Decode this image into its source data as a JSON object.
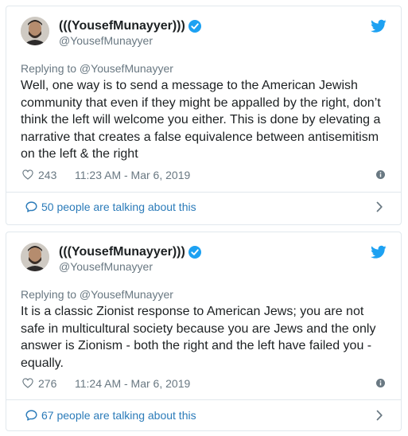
{
  "tweets": [
    {
      "display_name": "(((YousefMunayyer)))",
      "handle": "@YousefMunayyer",
      "replying_to": "Replying to @YousefMunayyer",
      "text": "Well, one way is to send a message to the American Jewish community that even if they might be appalled by the right, don’t think the left will welcome you either. This is done by elevating a narrative that creates a false equivalence between antisemitism on the left & the right",
      "likes": "243",
      "timestamp": "11:23 AM - Mar 6, 2019",
      "talking_about": "50 people are talking about this"
    },
    {
      "display_name": "(((YousefMunayyer)))",
      "handle": "@YousefMunayyer",
      "replying_to": "Replying to @YousefMunayyer",
      "text": "It is a classic Zionist response to American Jews; you are not safe in multicultural society because you are Jews and the only answer is Zionism - both the right and the left have failed you - equally.",
      "likes": "276",
      "timestamp": "11:24 AM - Mar 6, 2019",
      "talking_about": "67 people are talking about this"
    }
  ],
  "icons": {
    "verified": "verified-badge-icon",
    "brand": "twitter-bird-icon",
    "like": "heart-icon",
    "info": "info-icon",
    "replies": "speech-bubble-icon",
    "expand": "chevron-right-icon"
  },
  "colors": {
    "twitter_blue": "#1da1f2",
    "link_blue": "#2b7bb9",
    "secondary_text": "#697882",
    "border": "#e1e8ed",
    "primary_text": "#1c2022"
  }
}
